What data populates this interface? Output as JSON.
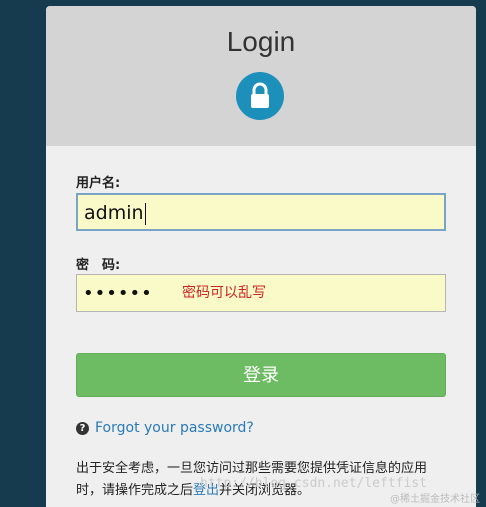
{
  "header": {
    "title": "Login",
    "lock_icon": "lock-icon"
  },
  "form": {
    "username_label": "用户名:",
    "username_value": "admin",
    "password_label": "密　码:",
    "password_value": "••••••",
    "password_hint": "密码可以乱写",
    "submit_label": "登录"
  },
  "forgot": {
    "icon": "question-circle-icon",
    "link_text": "Forgot your password?"
  },
  "notice": {
    "text_before": "出于安全考虑，一旦您访问过那些需要您提供凭证信息的应用时，请操作完成之后",
    "link_text": "登出",
    "text_after": "并关闭浏览器。"
  },
  "watermark": {
    "url": "http://blog.csdn.net/leftfist",
    "badge": "@稀土掘金技术社区"
  },
  "colors": {
    "background": "#163b4f",
    "header_bg": "#d4d4d4",
    "lock_circle": "#1c8fbb",
    "input_bg": "#fafac8",
    "button_bg": "#6dbb62",
    "hint_text": "#cc2222",
    "link": "#2a7ab8"
  }
}
